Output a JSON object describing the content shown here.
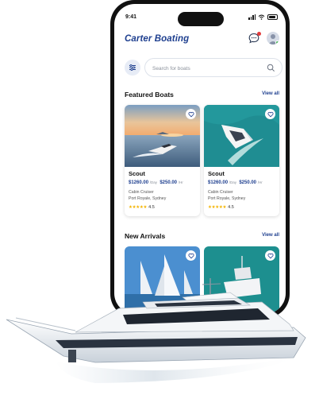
{
  "status_bar": {
    "time": "9:41"
  },
  "header": {
    "brand": "Carter Boating"
  },
  "search": {
    "placeholder": "Search for boats"
  },
  "featured": {
    "title": "Featured Boats",
    "view_all": "View all",
    "cards": [
      {
        "name": "Scout",
        "price_day": "$1260.00",
        "day_unit": "/Day",
        "price_hr": "$250.00",
        "hr_unit": "/Hr",
        "type": "Cabin Cruiser",
        "location": "Port Royale, Sydney",
        "stars": "★★★★★",
        "rating": "4.5"
      },
      {
        "name": "Scout",
        "price_day": "$1260.00",
        "day_unit": "/Day",
        "price_hr": "$250.00",
        "hr_unit": "/Hr",
        "type": "Cabin Cruiser",
        "location": "Port Royale, Sydney",
        "stars": "★★★★★",
        "rating": "4.5"
      }
    ]
  },
  "new_arrivals": {
    "title": "New Arrivals",
    "view_all": "View all"
  },
  "colors": {
    "brand": "#1e3f8f",
    "star": "#f4b400",
    "badge": "#e23b3b"
  },
  "icons": [
    "chat-icon",
    "avatar",
    "filter-icon",
    "search-icon",
    "heart-icon"
  ]
}
